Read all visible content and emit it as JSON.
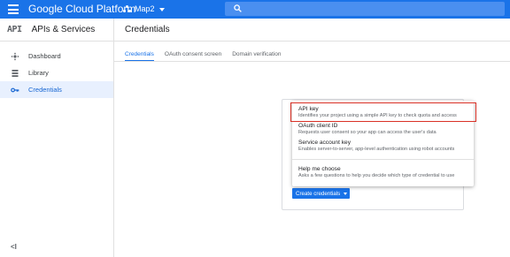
{
  "topbar": {
    "brand": "Google Cloud Platform",
    "project": "Map2"
  },
  "sidebar": {
    "logo": "API",
    "title": "APIs & Services",
    "items": [
      {
        "label": "Dashboard",
        "icon": "dashboard-icon"
      },
      {
        "label": "Library",
        "icon": "library-icon"
      },
      {
        "label": "Credentials",
        "icon": "key-icon"
      }
    ],
    "collapse_label": "<I"
  },
  "main": {
    "title": "Credentials",
    "tabs": [
      {
        "label": "Credentials"
      },
      {
        "label": "OAuth consent screen"
      },
      {
        "label": "Domain verification"
      }
    ],
    "create_button": "Create credentials"
  },
  "dropdown": {
    "options": [
      {
        "title": "API key",
        "desc": "Identifies your project using a simple API key to check quota and access"
      },
      {
        "title": "OAuth client ID",
        "desc": "Requests user consent so your app can access the user's data"
      },
      {
        "title": "Service account key",
        "desc": "Enables server-to-server, app-level authentication using robot accounts"
      },
      {
        "title": "Help me choose",
        "desc": "Asks a few questions to help you decide which type of credential to use"
      }
    ]
  },
  "colors": {
    "topbar": "#1a73e8",
    "active_item_bg": "#e8f0fe",
    "highlight_border": "#d93025"
  }
}
